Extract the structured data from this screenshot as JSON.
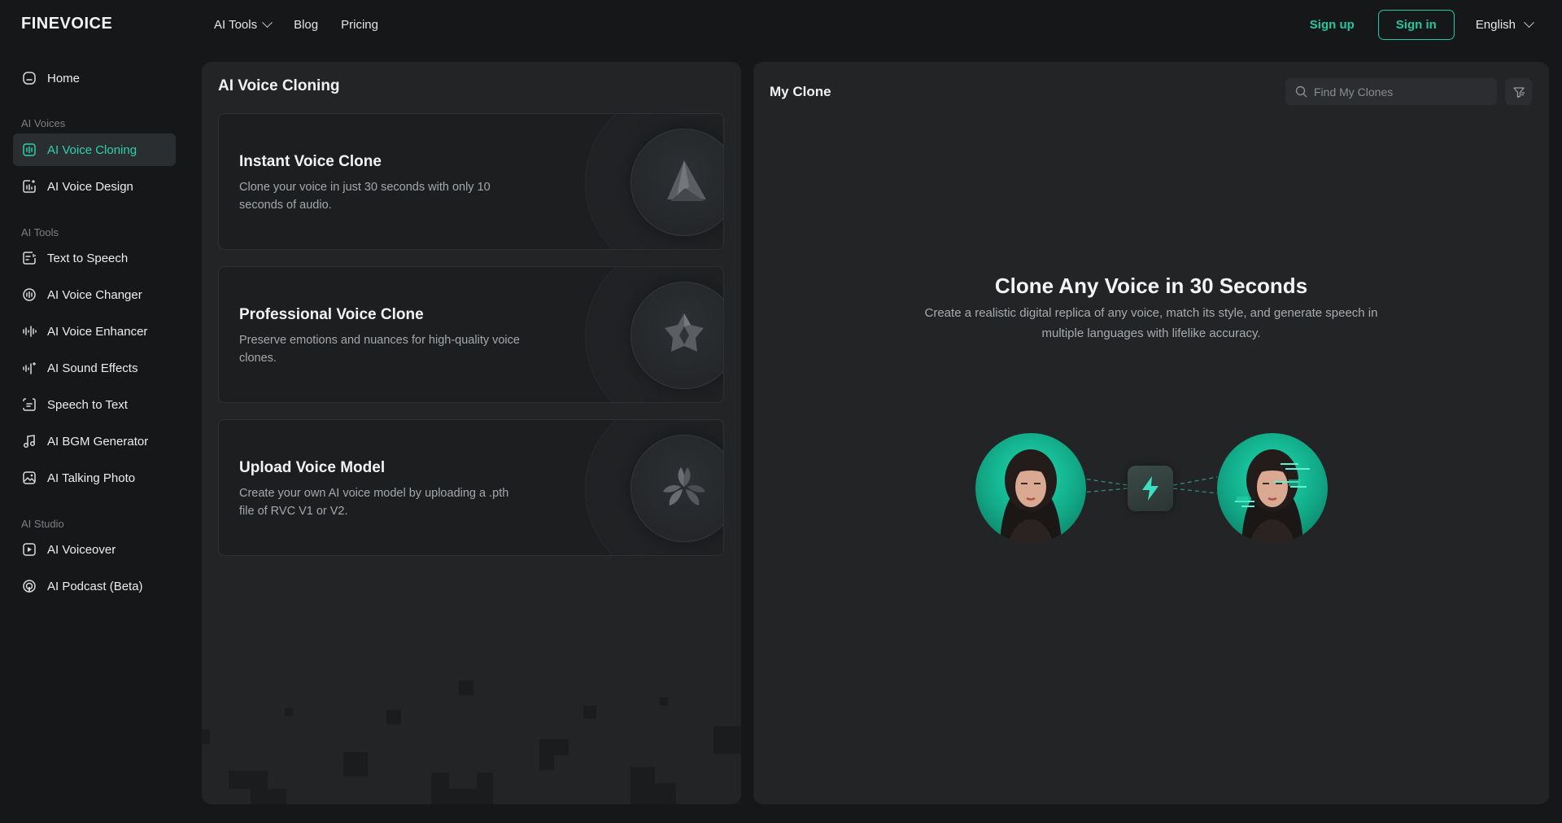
{
  "header": {
    "logo": "FINEVOICE",
    "nav": [
      {
        "label": "AI Tools",
        "has_dropdown": true
      },
      {
        "label": "Blog"
      },
      {
        "label": "Pricing"
      }
    ],
    "signup_label": "Sign up",
    "signin_label": "Sign in",
    "language": "English"
  },
  "sidebar": {
    "home": "Home",
    "groups": [
      {
        "title": "AI Voices",
        "items": [
          "AI Voice Cloning",
          "AI Voice Design"
        ]
      },
      {
        "title": "AI Tools",
        "items": [
          "Text to Speech",
          "AI Voice Changer",
          "AI Voice Enhancer",
          "AI Sound Effects",
          "Speech to Text",
          "AI BGM Generator",
          "AI Talking Photo"
        ]
      },
      {
        "title": "AI Studio",
        "items": [
          "AI Voiceover",
          "AI Podcast (Beta)"
        ]
      }
    ],
    "active_item": "AI Voice Cloning"
  },
  "left_panel": {
    "title": "AI Voice Cloning",
    "cards": [
      {
        "title": "Instant Voice Clone",
        "description": "Clone your voice in just 30 seconds with only 10 seconds of audio.",
        "icon": "triangle-logo-icon"
      },
      {
        "title": "Professional Voice Clone",
        "description": "Preserve emotions and nuances for high-quality voice clones.",
        "icon": "star-logo-icon"
      },
      {
        "title": "Upload Voice Model",
        "description": "Create your own AI voice model by uploading a .pth file of RVC V1 or V2.",
        "icon": "flower-logo-icon"
      }
    ]
  },
  "right_panel": {
    "title": "My Clone",
    "search_placeholder": "Find My Clones",
    "hero_title": "Clone Any Voice in 30 Seconds",
    "hero_description": "Create a realistic digital replica of any voice, match its style, and generate speech in multiple languages with lifelike accuracy."
  },
  "colors": {
    "accent": "#22c7a3",
    "background": "#161718",
    "panel": "#222426"
  }
}
